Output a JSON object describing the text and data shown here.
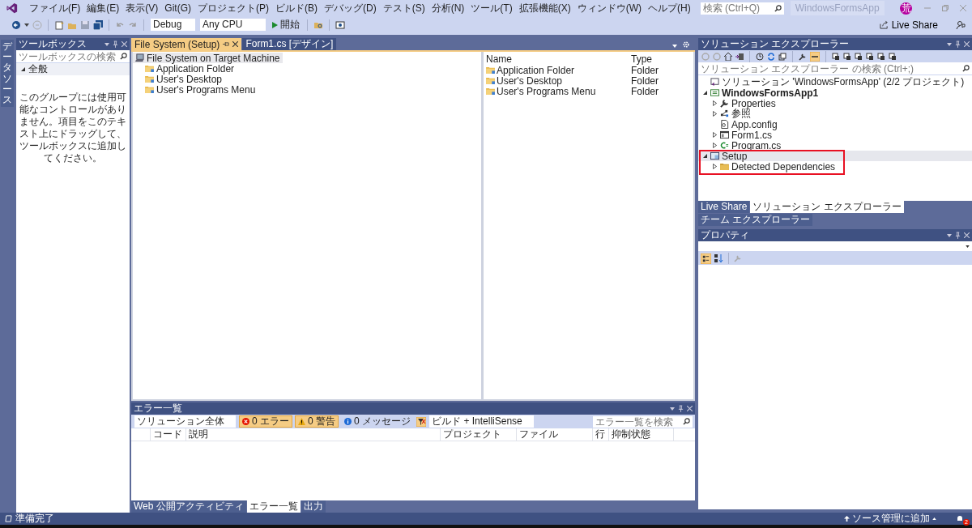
{
  "menu": [
    "ファイル(F)",
    "編集(E)",
    "表示(V)",
    "Git(G)",
    "プロジェクト(P)",
    "ビルド(B)",
    "デバッグ(D)",
    "テスト(S)",
    "分析(N)",
    "ツール(T)",
    "拡張機能(X)",
    "ウィンドウ(W)",
    "ヘルプ(H)"
  ],
  "search": {
    "placeholder": "検索 (Ctrl+Q)"
  },
  "app_title": "WindowsFormsApp",
  "avatar": "荒",
  "live_share": "Live Share",
  "toolbar": {
    "configuration": "Debug",
    "platform": "Any CPU",
    "start": "開始"
  },
  "side_tab": "データソース",
  "toolbox": {
    "title": "ツールボックス",
    "search_placeholder": "ツールボックスの検索",
    "group": "全般",
    "message": "このグループには使用可能なコントロールがありません。項目をこのテキスト上にドラッグして、ツールボックスに追加してください。"
  },
  "document_tabs": [
    {
      "label": "File System (Setup)",
      "selected": true
    },
    {
      "label": "Form1.cs [デザイン]",
      "selected": false
    }
  ],
  "file_system": {
    "root": {
      "label": "File System on Target Machine",
      "selected": true
    },
    "folders": [
      {
        "label": "Application Folder",
        "selected": false
      },
      {
        "label": "User's Desktop",
        "selected": false
      },
      {
        "label": "User's Programs Menu",
        "selected": false
      }
    ],
    "columns": [
      "Name",
      "Type"
    ],
    "rows": [
      {
        "name": "Application Folder",
        "type": "Folder"
      },
      {
        "name": "User's Desktop",
        "type": "Folder"
      },
      {
        "name": "User's Programs Menu",
        "type": "Folder"
      }
    ]
  },
  "error_list": {
    "title": "エラー一覧",
    "scope": "ソリューション全体",
    "filters": [
      {
        "label": "0 エラー",
        "kind": "error",
        "selected": true
      },
      {
        "label": "0 警告",
        "kind": "warning",
        "selected": true
      },
      {
        "label": "0 メッセージ",
        "kind": "info",
        "selected": false
      }
    ],
    "source": "ビルド + IntelliSense",
    "search_placeholder": "エラー一覧を検索",
    "columns": [
      "コード",
      "説明",
      "プロジェクト",
      "ファイル",
      "行",
      "抑制状態"
    ]
  },
  "bottom_tabs": [
    {
      "label": "Web 公開アクティビティ",
      "selected": false
    },
    {
      "label": "エラー一覧",
      "selected": true
    },
    {
      "label": "出力",
      "selected": false
    }
  ],
  "solution_explorer": {
    "title": "ソリューション エクスプローラー",
    "search_placeholder": "ソリューション エクスプローラー の検索 (Ctrl+;)",
    "tree": [
      {
        "label": "ソリューション 'WindowsFormsApp' (2/2 プロジェクト)",
        "kind": "solution",
        "children": [
          {
            "label": "WindowsFormsApp1",
            "kind": "project",
            "bold": true,
            "expanded": true,
            "children": [
              {
                "label": "Properties",
                "kind": "wrench",
                "expanded": false
              },
              {
                "label": "参照",
                "kind": "references",
                "expanded": false
              },
              {
                "label": "App.config",
                "kind": "config"
              },
              {
                "label": "Form1.cs",
                "kind": "form",
                "expanded": false
              },
              {
                "label": "Program.cs",
                "kind": "csharp",
                "expanded": false
              }
            ]
          },
          {
            "label": "Setup",
            "kind": "setup",
            "expanded": true,
            "selected": true,
            "highlighted": true,
            "children": [
              {
                "label": "Detected Dependencies",
                "kind": "folder",
                "expanded": false
              }
            ]
          }
        ]
      }
    ]
  },
  "side_tabs": [
    {
      "label": "Live Share",
      "selected": false
    },
    {
      "label": "ソリューション エクスプローラー",
      "selected": true
    },
    {
      "label": "チーム エクスプローラー",
      "selected": false
    }
  ],
  "properties": {
    "title": "プロパティ"
  },
  "status_bar": {
    "text": "準備完了",
    "source_control": "ソース管理に追加",
    "notifications": "2"
  }
}
